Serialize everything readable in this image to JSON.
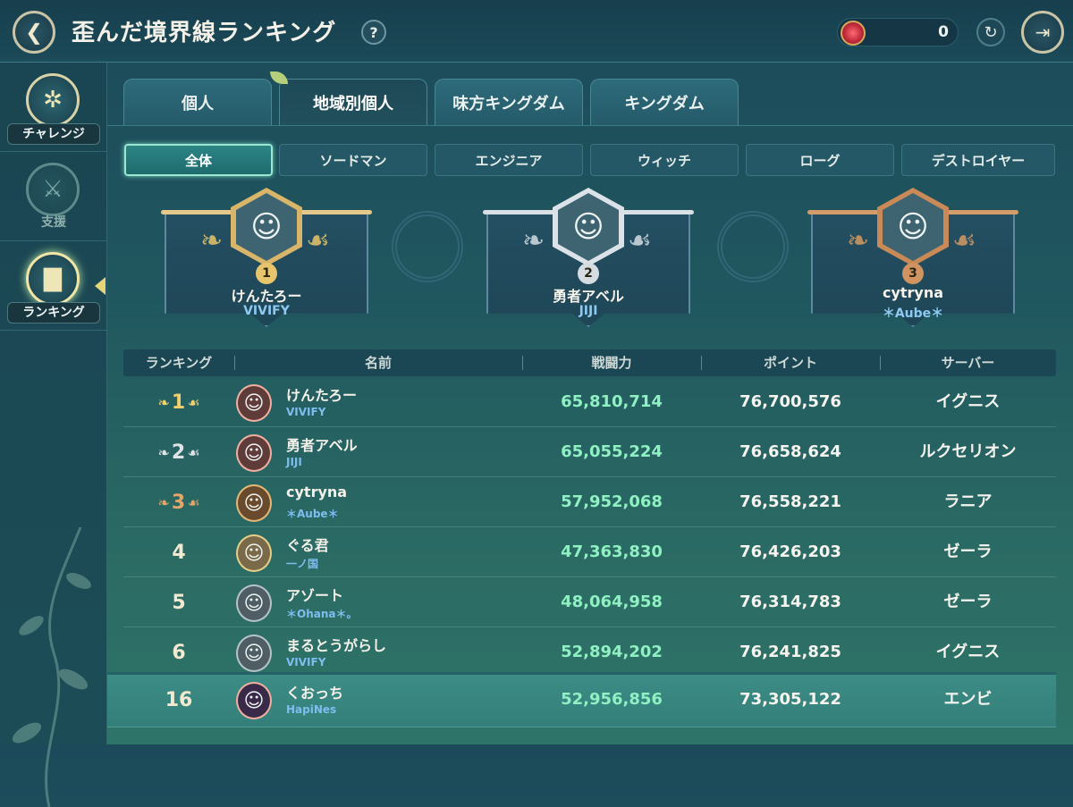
{
  "header": {
    "title": "歪んだ境界線ランキング",
    "help_label": "?",
    "currency_value": "0",
    "back_icon": "back-arrow-icon",
    "exit_icon": "exit-door-icon",
    "refresh_icon": "refresh-icon"
  },
  "sidebar": {
    "items": [
      {
        "label": "チャレンジ",
        "icon": "compass-icon",
        "state": "normal"
      },
      {
        "label": "支援",
        "icon": "crossed-swords-hands-icon",
        "state": "disabled"
      },
      {
        "label": "ランキング",
        "icon": "podium-icon",
        "state": "active"
      }
    ]
  },
  "tabs": [
    {
      "label": "個人",
      "active": false
    },
    {
      "label": "地域別個人",
      "active": true
    },
    {
      "label": "味方キングダム",
      "active": false
    },
    {
      "label": "キングダム",
      "active": false
    }
  ],
  "filters": [
    {
      "label": "全体",
      "active": true
    },
    {
      "label": "ソードマン",
      "active": false
    },
    {
      "label": "エンジニア",
      "active": false
    },
    {
      "label": "ウィッチ",
      "active": false
    },
    {
      "label": "ローグ",
      "active": false
    },
    {
      "label": "デストロイヤー",
      "active": false
    }
  ],
  "podium": [
    {
      "rank": "1",
      "name": "けんたろー",
      "guild": "VIVIFY",
      "medal": "gold"
    },
    {
      "rank": "2",
      "name": "勇者アベル",
      "guild": "JIJI",
      "medal": "silver"
    },
    {
      "rank": "3",
      "name": "cytryna",
      "guild": "＊Aube＊",
      "medal": "bronze"
    }
  ],
  "table": {
    "columns": [
      "ランキング",
      "名前",
      "戦闘力",
      "ポイント",
      "サーバー"
    ],
    "rows": [
      {
        "rank": "1",
        "name": "けんたろー",
        "guild": "VIVIFY",
        "power": "65,810,714",
        "points": "76,700,576",
        "server": "イグニス"
      },
      {
        "rank": "2",
        "name": "勇者アベル",
        "guild": "JIJI",
        "power": "65,055,224",
        "points": "76,658,624",
        "server": "ルクセリオン"
      },
      {
        "rank": "3",
        "name": "cytryna",
        "guild": "＊Aube＊",
        "power": "57,952,068",
        "points": "76,558,221",
        "server": "ラニア"
      },
      {
        "rank": "4",
        "name": "ぐる君",
        "guild": "一ノ国",
        "power": "47,363,830",
        "points": "76,426,203",
        "server": "ゼーラ"
      },
      {
        "rank": "5",
        "name": "アゾート",
        "guild": "＊Ohana＊。",
        "power": "48,064,958",
        "points": "76,314,783",
        "server": "ゼーラ"
      },
      {
        "rank": "6",
        "name": "まるとうがらし",
        "guild": "VIVIFY",
        "power": "52,894,202",
        "points": "76,241,825",
        "server": "イグニス"
      }
    ],
    "my_row": {
      "rank": "16",
      "name": "くおっち",
      "guild": "HapiNes",
      "power": "52,956,856",
      "points": "73,305,122",
      "server": "エンビ"
    }
  }
}
